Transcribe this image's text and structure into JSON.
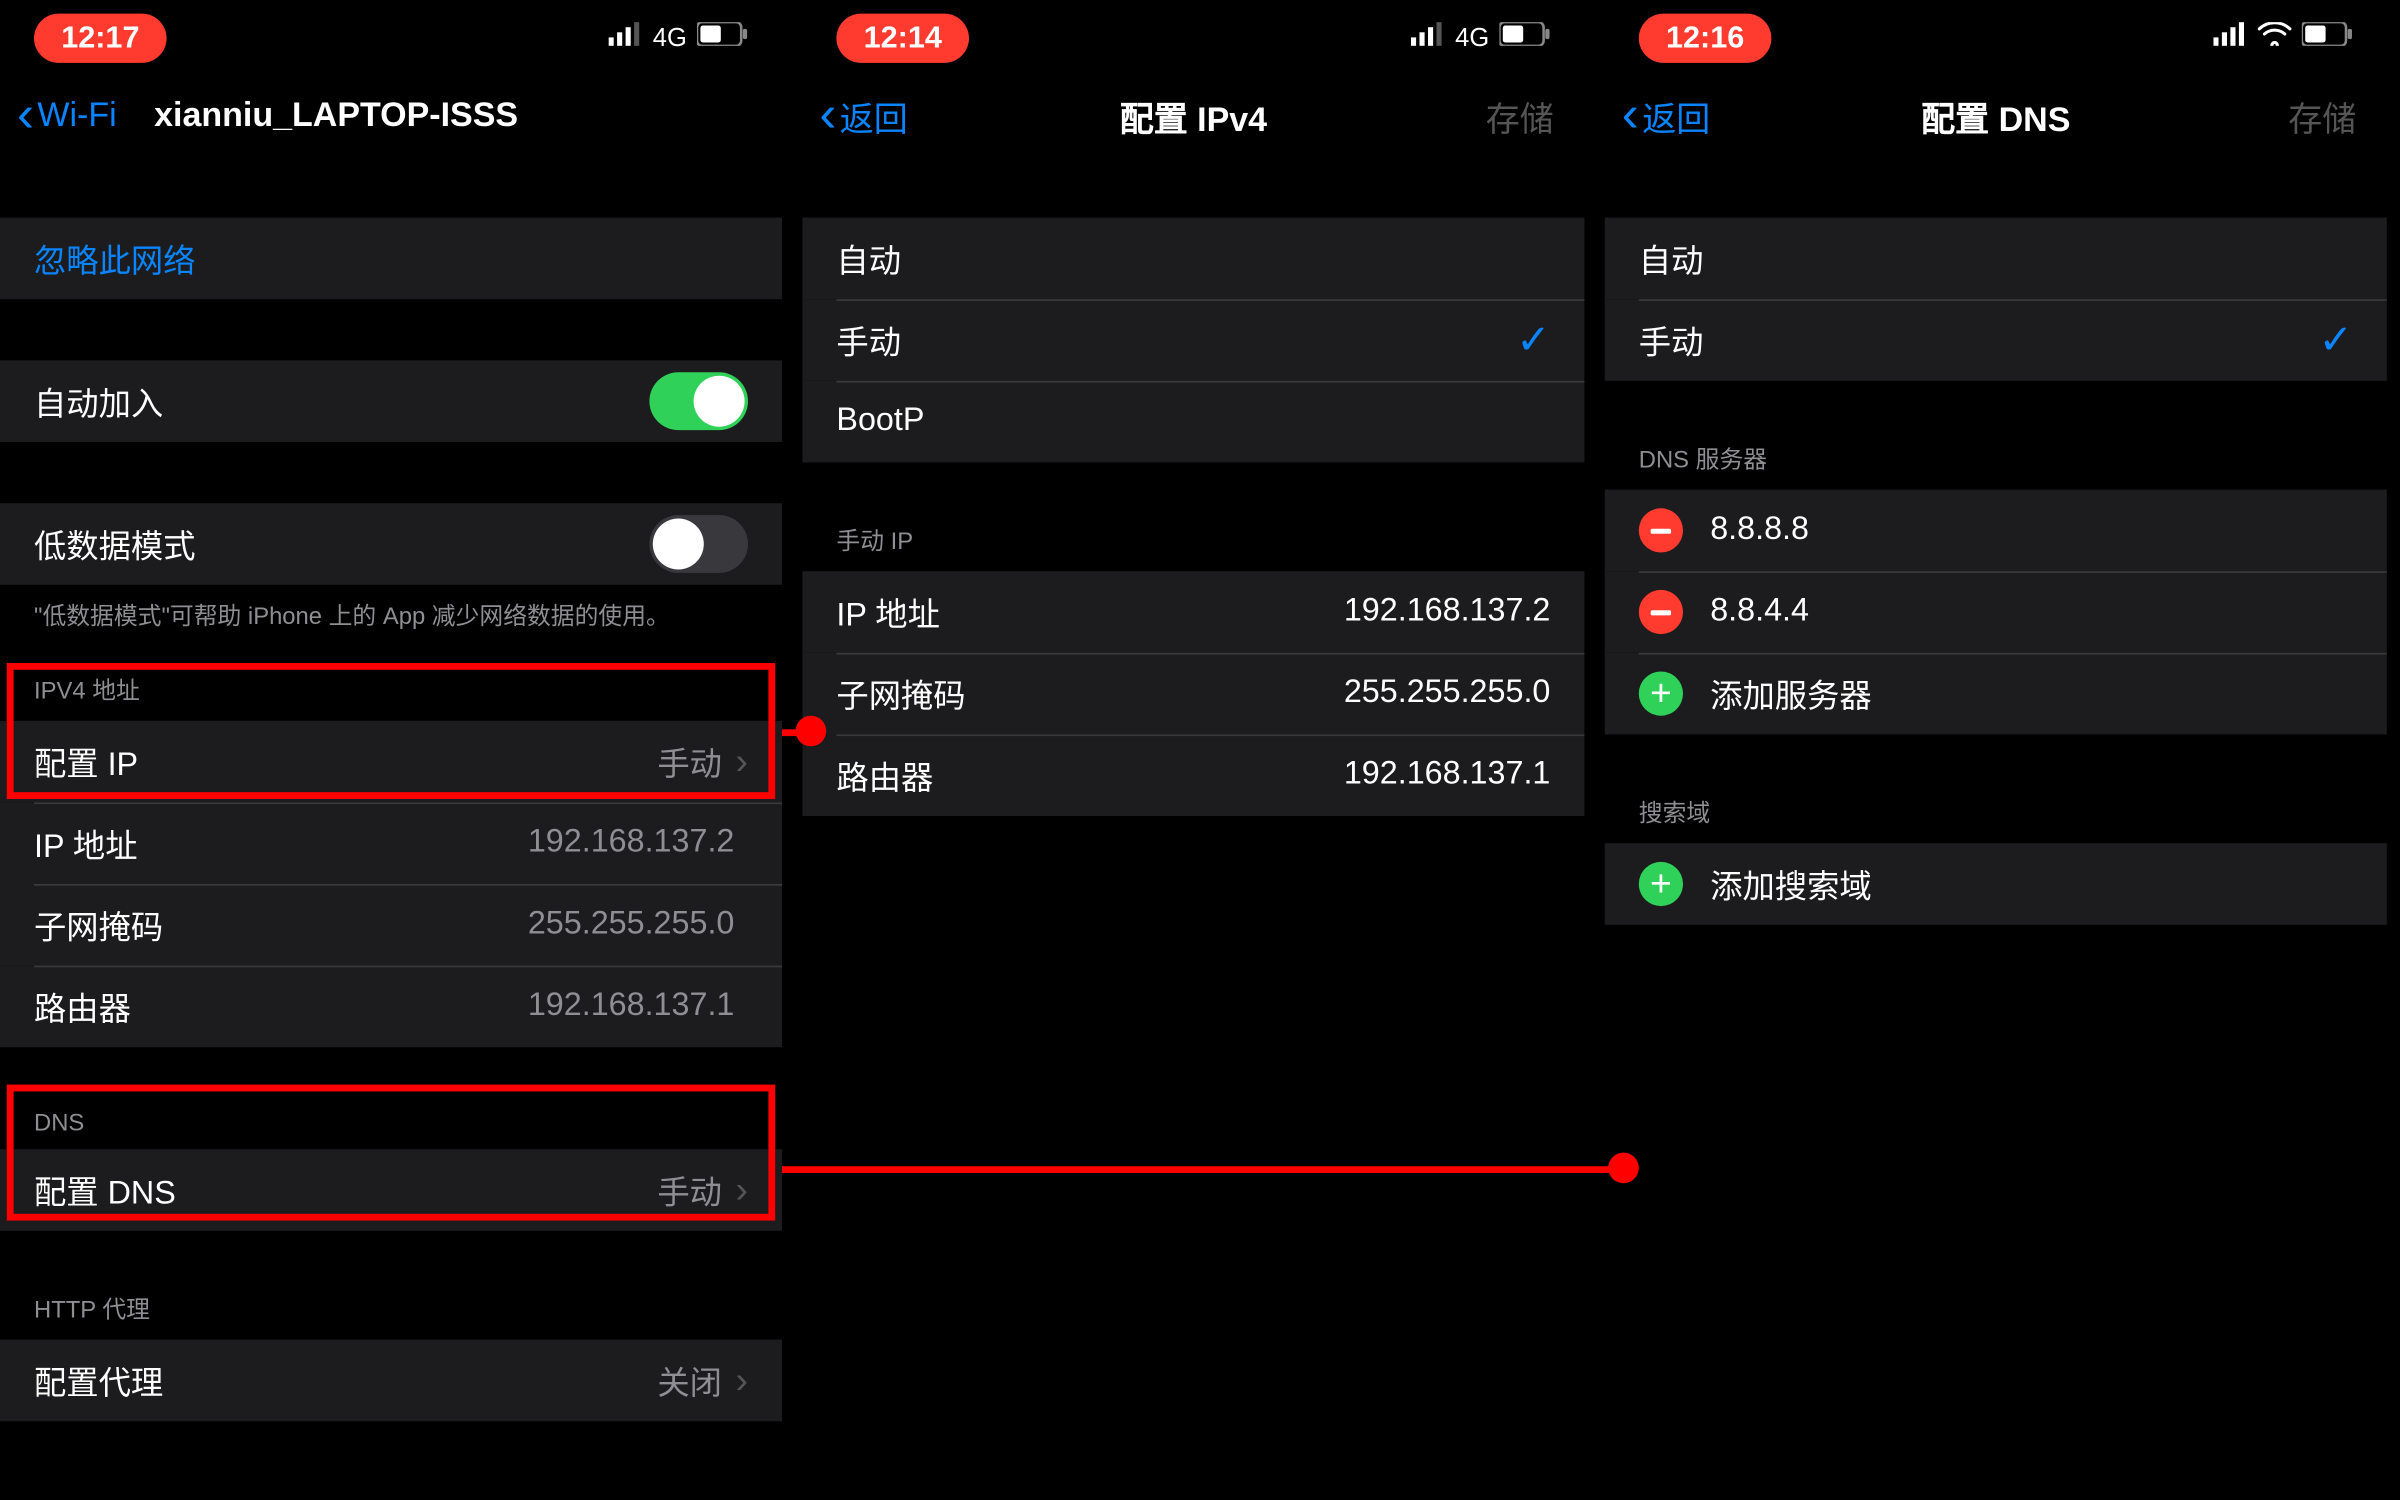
{
  "phone1": {
    "time": "12:17",
    "network": "4G",
    "back_label": "Wi-Fi",
    "title": "xianniu_LAPTOP-ISSS",
    "forget": "忽略此网络",
    "auto_join": "自动加入",
    "low_data": "低数据模式",
    "low_data_note": "\"低数据模式\"可帮助 iPhone 上的 App 减少网络数据的使用。",
    "ipv4_header": "IPV4 地址",
    "configure_ip": "配置 IP",
    "configure_ip_value": "手动",
    "ip_label": "IP 地址",
    "ip_value": "192.168.137.2",
    "subnet_label": "子网掩码",
    "subnet_value": "255.255.255.0",
    "router_label": "路由器",
    "router_value": "192.168.137.1",
    "dns_header": "DNS",
    "configure_dns": "配置 DNS",
    "configure_dns_value": "手动",
    "http_header": "HTTP 代理",
    "configure_proxy": "配置代理",
    "configure_proxy_value": "关闭"
  },
  "phone2": {
    "time": "12:14",
    "network": "4G",
    "back_label": "返回",
    "title": "配置 IPv4",
    "save": "存储",
    "auto": "自动",
    "manual": "手动",
    "bootp": "BootP",
    "manual_ip_header": "手动 IP",
    "ip_label": "IP 地址",
    "ip_value": "192.168.137.2",
    "subnet_label": "子网掩码",
    "subnet_value": "255.255.255.0",
    "router_label": "路由器",
    "router_value": "192.168.137.1"
  },
  "phone3": {
    "time": "12:16",
    "back_label": "返回",
    "title": "配置 DNS",
    "save": "存储",
    "auto": "自动",
    "manual": "手动",
    "dns_servers_header": "DNS 服务器",
    "dns1": "8.8.8.8",
    "dns2": "8.8.4.4",
    "add_server": "添加服务器",
    "search_header": "搜索域",
    "add_search": "添加搜索域"
  }
}
